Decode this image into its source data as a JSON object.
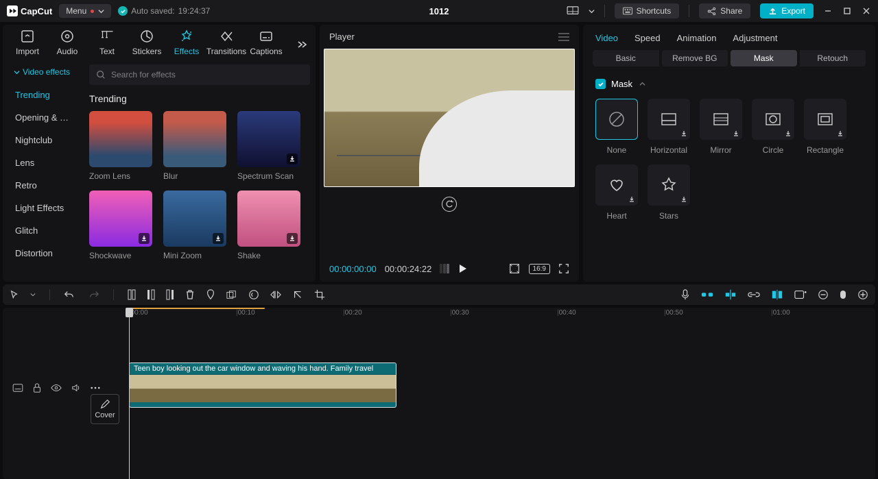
{
  "titlebar": {
    "brand": "CapCut",
    "menu": "Menu",
    "autosave_prefix": "Auto saved:",
    "autosave_time": "19:24:37",
    "project": "1012",
    "shortcuts": "Shortcuts",
    "share": "Share",
    "export": "Export"
  },
  "left": {
    "tabs": [
      "Import",
      "Audio",
      "Text",
      "Stickers",
      "Effects",
      "Transitions",
      "Captions"
    ],
    "active_tab": 4,
    "video_effects_pill": "Video effects",
    "search_placeholder": "Search for effects",
    "categories": [
      "Trending",
      "Opening & …",
      "Nightclub",
      "Lens",
      "Retro",
      "Light Effects",
      "Glitch",
      "Distortion"
    ],
    "active_category": 0,
    "section_title": "Trending",
    "effects": [
      {
        "name": "Zoom Lens",
        "download": false
      },
      {
        "name": "Blur",
        "download": false
      },
      {
        "name": "Spectrum Scan",
        "download": true
      },
      {
        "name": "Shockwave",
        "download": true
      },
      {
        "name": "Mini Zoom",
        "download": true
      },
      {
        "name": "Shake",
        "download": true
      }
    ]
  },
  "player": {
    "title": "Player",
    "current": "00:00:00:00",
    "duration": "00:00:24:22",
    "ratio": "16:9"
  },
  "right": {
    "tabs": [
      "Video",
      "Speed",
      "Animation",
      "Adjustment"
    ],
    "active_tab": 0,
    "subtabs": [
      "Basic",
      "Remove BG",
      "Mask",
      "Retouch"
    ],
    "active_subtab": 2,
    "mask_label": "Mask",
    "mask_checked": true,
    "masks": [
      {
        "name": "None",
        "selected": true,
        "download": false
      },
      {
        "name": "Horizontal",
        "download": true
      },
      {
        "name": "Mirror",
        "download": true
      },
      {
        "name": "Circle",
        "download": true
      },
      {
        "name": "Rectangle",
        "download": true
      },
      {
        "name": "Heart",
        "download": true
      },
      {
        "name": "Stars",
        "download": true
      }
    ]
  },
  "timeline": {
    "marks": [
      "00:00",
      "00:10",
      "00:20",
      "00:30",
      "00:40",
      "00:50",
      "01:00"
    ],
    "cover": "Cover",
    "clip_label": "Teen boy looking out the car window and waving his hand. Family travel"
  }
}
